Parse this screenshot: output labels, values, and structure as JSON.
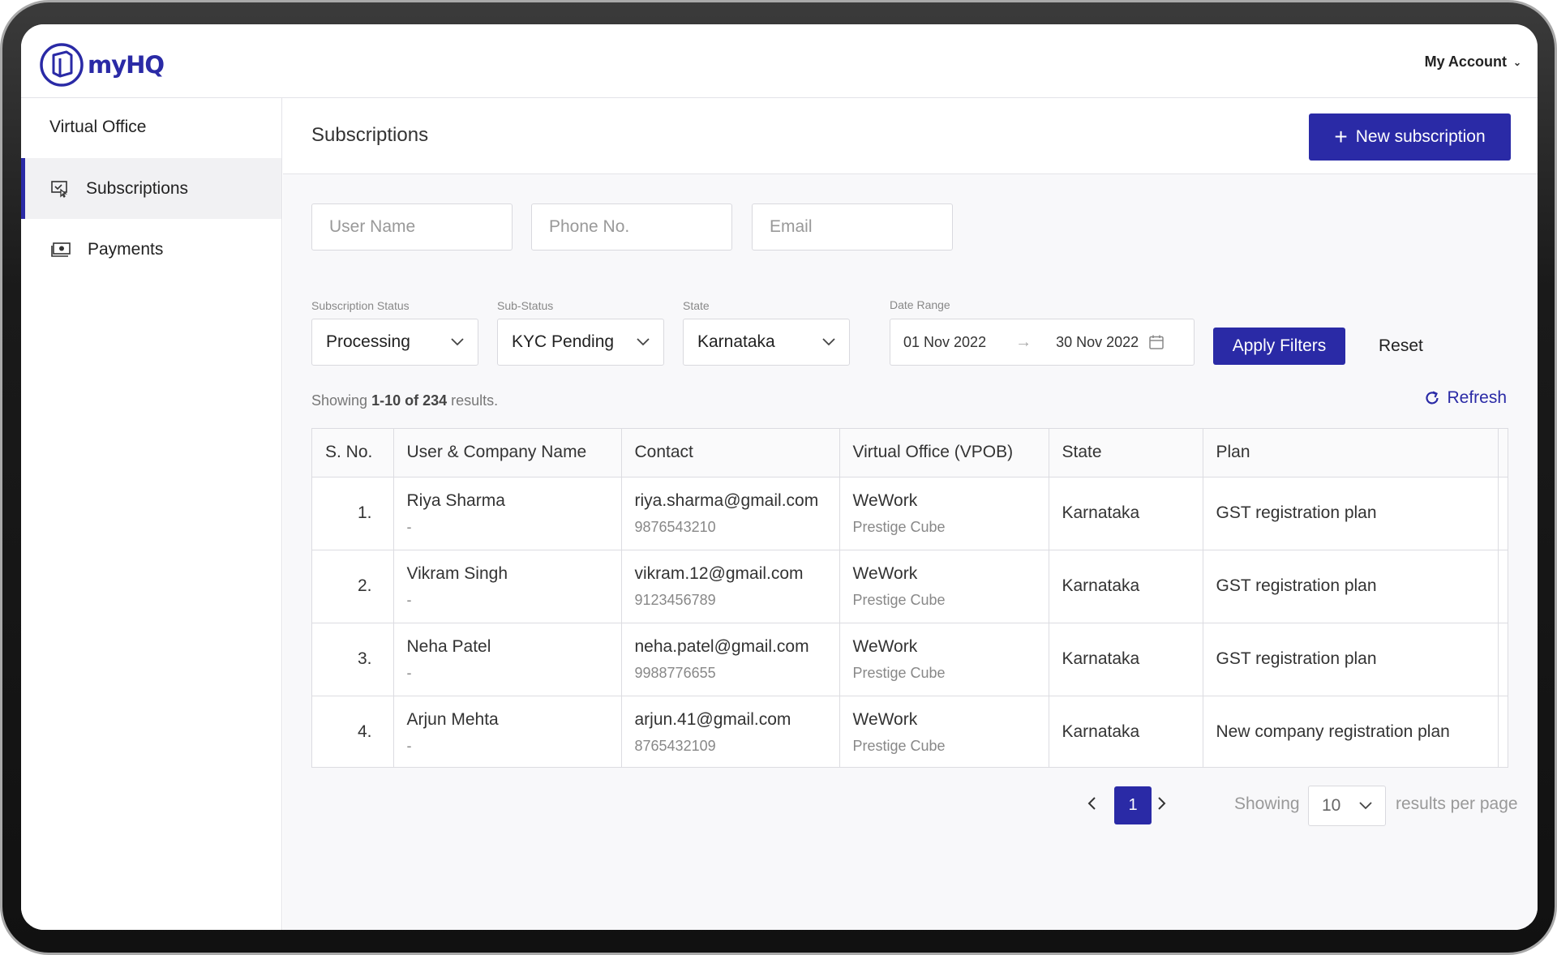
{
  "brand": {
    "name": "myHQ",
    "color": "#2a2aa6"
  },
  "account": {
    "label": "My Account"
  },
  "sidebar": {
    "heading": "Virtual Office",
    "items": [
      {
        "label": "Subscriptions",
        "icon": "subscriptions-icon",
        "active": true
      },
      {
        "label": "Payments",
        "icon": "payments-icon",
        "active": false
      }
    ]
  },
  "header": {
    "title": "Subscriptions",
    "new_button": "New subscription"
  },
  "search": {
    "user_name_placeholder": "User Name",
    "phone_placeholder": "Phone No.",
    "email_placeholder": "Email"
  },
  "filters": {
    "status": {
      "label": "Subscription Status",
      "value": "Processing"
    },
    "sub_status": {
      "label": "Sub-Status",
      "value": "KYC Pending"
    },
    "state": {
      "label": "State",
      "value": "Karnataka"
    },
    "date_range": {
      "label": "Date Range",
      "start": "01 Nov 2022",
      "end": "30 Nov 2022"
    },
    "apply_label": "Apply Filters",
    "reset_label": "Reset"
  },
  "results": {
    "prefix": "Showing ",
    "range": "1-10 of 234",
    "suffix": " results.",
    "refresh_label": "Refresh"
  },
  "table": {
    "columns": [
      "S. No.",
      "User & Company Name",
      "Contact",
      "Virtual Office (VPOB)",
      "State",
      "Plan"
    ],
    "rows": [
      {
        "num": "1.",
        "name": "Riya Sharma",
        "company": "-",
        "email": "riya.sharma@gmail.com",
        "phone": "9876543210",
        "vo": "WeWork",
        "vo_sub": "Prestige Cube",
        "state": "Karnataka",
        "plan": "GST registration plan"
      },
      {
        "num": "2.",
        "name": "Vikram Singh",
        "company": "-",
        "email": "vikram.12@gmail.com",
        "phone": "9123456789",
        "vo": "WeWork",
        "vo_sub": "Prestige Cube",
        "state": "Karnataka",
        "plan": "GST registration plan"
      },
      {
        "num": "3.",
        "name": "Neha Patel",
        "company": "-",
        "email": "neha.patel@gmail.com",
        "phone": "9988776655",
        "vo": "WeWork",
        "vo_sub": "Prestige Cube",
        "state": "Karnataka",
        "plan": "GST registration plan"
      },
      {
        "num": "4.",
        "name": "Arjun Mehta",
        "company": "-",
        "email": "arjun.41@gmail.com",
        "phone": "8765432109",
        "vo": "WeWork",
        "vo_sub": "Prestige Cube",
        "state": "Karnataka",
        "plan": "New company registration plan"
      }
    ]
  },
  "pagination": {
    "current_page": "1",
    "showing_label": "Showing",
    "per_page": "10",
    "per_page_suffix": "results per page"
  }
}
